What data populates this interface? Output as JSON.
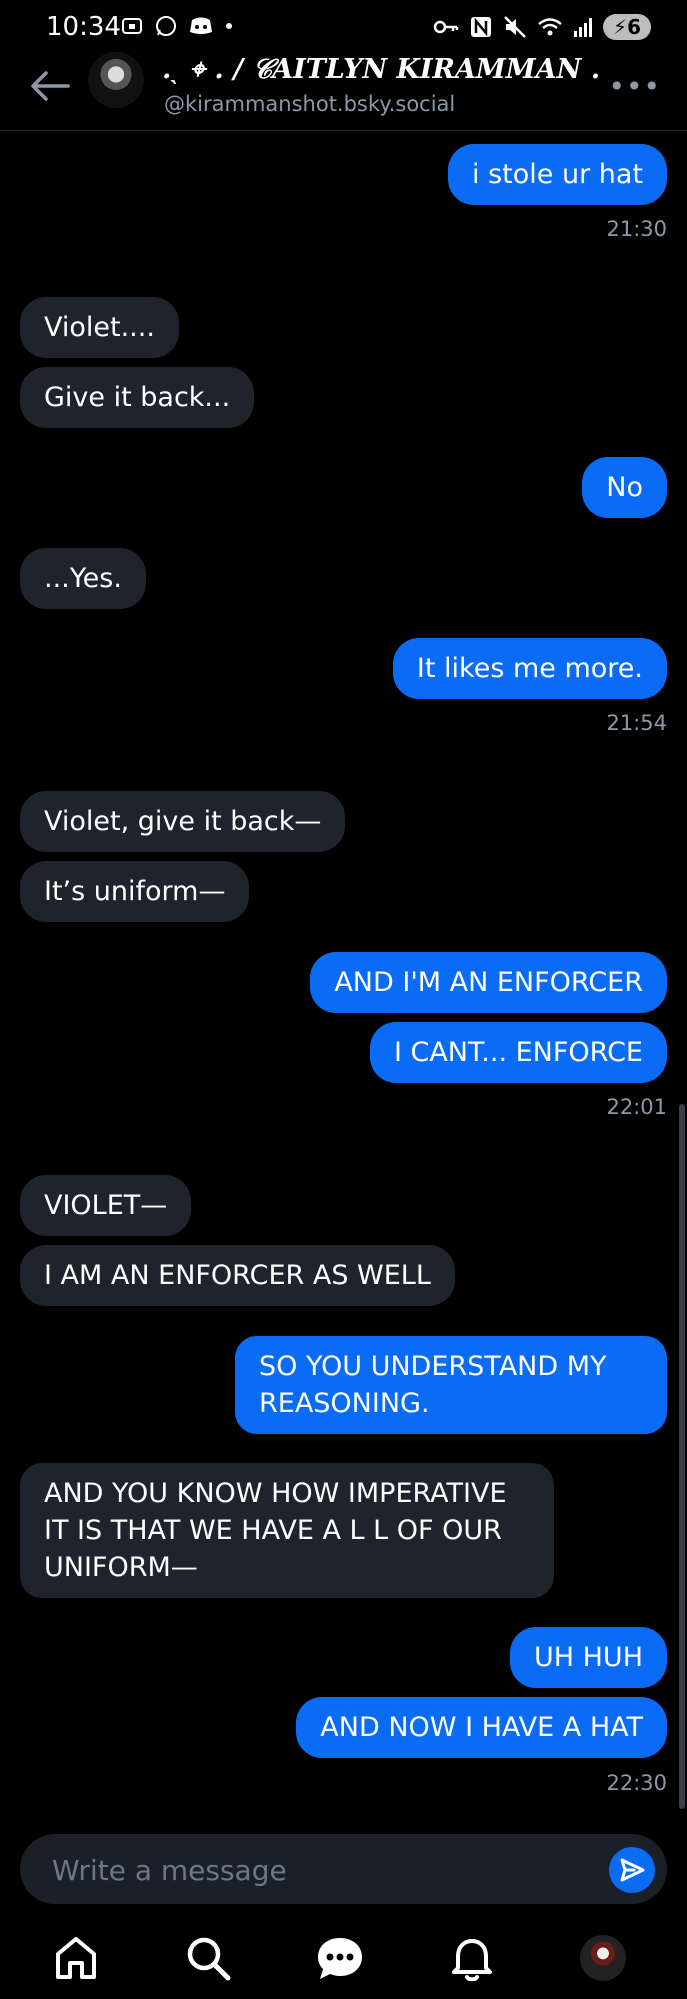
{
  "status_bar": {
    "time": "10:34",
    "battery": "6"
  },
  "header": {
    "display_name": ".ˎ ⌖ . / 𝒞AITLYN KIRAMMAN .",
    "handle": "@kirammanshot.bsky.social",
    "more_label": "•••"
  },
  "messages": [
    {
      "from": "me",
      "text": "i stole ur hat"
    },
    {
      "timestamp": "21:30"
    },
    {
      "from": "them",
      "text": " Violet...."
    },
    {
      "from": "them",
      "text": "Give it back..."
    },
    {
      "from": "me",
      "text": "No"
    },
    {
      "from": "them",
      "text": "...Yes."
    },
    {
      "from": "me",
      "text": "It likes me more."
    },
    {
      "timestamp": "21:54"
    },
    {
      "from": "them",
      "text": "Violet, give it back—"
    },
    {
      "from": "them",
      "text": "It’s uniform—"
    },
    {
      "from": "me",
      "text": "AND I'M AN ENFORCER"
    },
    {
      "from": "me",
      "text": "I CANT... ENFORCE"
    },
    {
      "timestamp": "22:01"
    },
    {
      "from": "them",
      "text": "VIOLET—"
    },
    {
      "from": "them",
      "text": "I AM AN ENFORCER AS WELL"
    },
    {
      "from": "me",
      "text": "SO YOU UNDERSTAND MY REASONING."
    },
    {
      "from": "them",
      "text": "AND YOU KNOW HOW IMPERATIVE IT IS THAT WE HAVE A L L   OF OUR UNIFORM—"
    },
    {
      "from": "me",
      "text": "UH HUH"
    },
    {
      "from": "me",
      "text": "AND NOW I HAVE A HAT"
    },
    {
      "timestamp": "22:30"
    }
  ],
  "composer": {
    "placeholder": "Write a message"
  },
  "tabs": [
    "home-icon",
    "search-icon",
    "chat-icon",
    "bell-icon",
    "profile-avatar"
  ],
  "colors": {
    "outgoing": "#0a6cf5",
    "incoming": "#1f232d",
    "muted": "#8b98a8"
  }
}
